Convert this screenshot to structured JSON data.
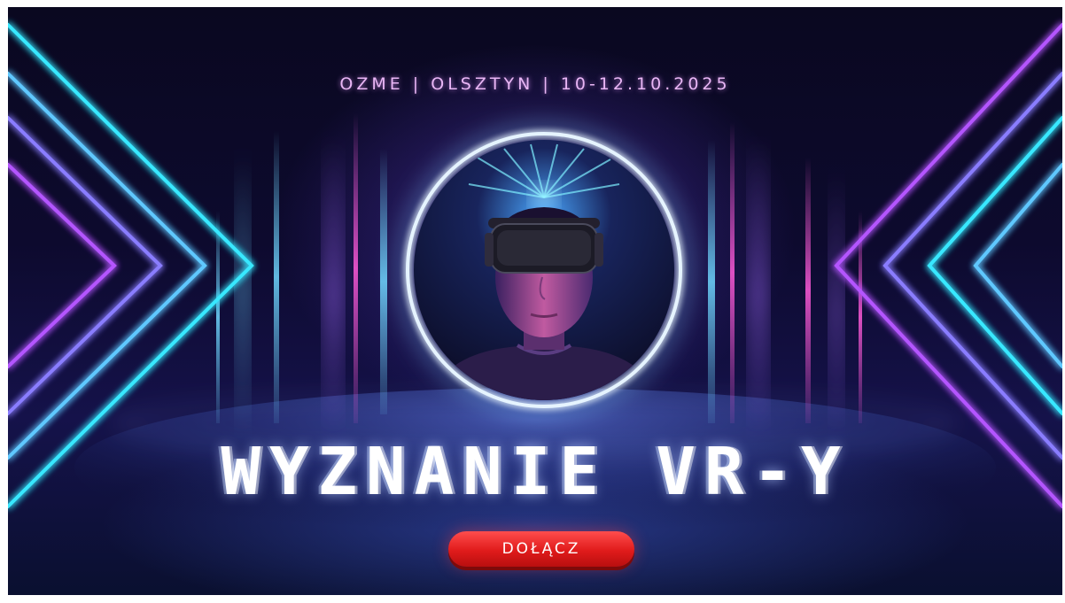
{
  "banner": {
    "event_info": "OZME | OLSZTYN | 10-12.10.2025",
    "headline": "WYZNANIE VR-Y",
    "join_button_label": "DOŁĄCZ"
  },
  "colors": {
    "background": "#0d0a2e",
    "neon_cyan": "#38e8ff",
    "neon_purple": "#b455ff",
    "neon_pink": "#ff5ad9",
    "accent_text": "#e9b6f5",
    "button_red": "#e01b1b"
  }
}
